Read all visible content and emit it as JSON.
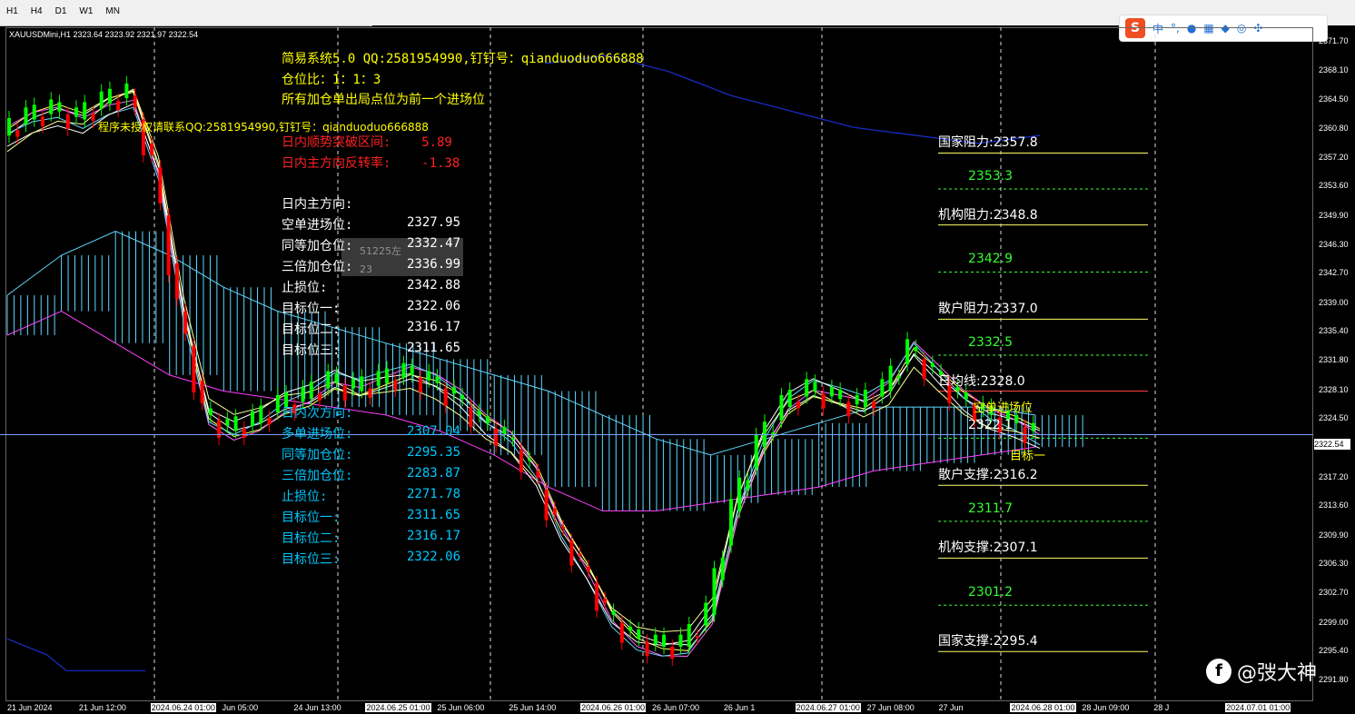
{
  "toolbar": {
    "timeframes": [
      "H1",
      "H4",
      "D1",
      "W1",
      "MN"
    ],
    "ime": {
      "logo": "S",
      "items": [
        "中",
        "°,",
        "mic-icon",
        "keyboard-icon",
        "shirt-icon",
        "game-icon",
        "tool-icon"
      ]
    }
  },
  "symbol_header": "XAUUSDMini,H1  2323.64 2323.92 2321.97 2322.54",
  "info_panel": {
    "line1": "简易系统5.0 QQ:2581954990,钉钉号：qianduoduo666888",
    "line2": "仓位比：1：1：3",
    "line3": "所有加仓单出局点位为前一个进场位",
    "auth": "程序未授权请联系QQ:2581954990,钉钉号：qianduoduo666888",
    "breakout": "日内顺势突破区间:    5.89",
    "reversal": "日内主方向反转率:    -1.38",
    "main_dir": "日内主方向:",
    "short_rows": [
      {
        "label": "空单进场位:",
        "value": "2327.95"
      },
      {
        "label": "同等加仓位:",
        "value": "2332.47"
      },
      {
        "label": "三倍加仓位:",
        "value": "2336.99"
      },
      {
        "label": "止损位:",
        "value": "2342.88"
      },
      {
        "label": "目标位一:",
        "value": "2322.06"
      },
      {
        "label": "目标位二:",
        "value": "2316.17"
      },
      {
        "label": "目标位三:",
        "value": "2311.65"
      }
    ],
    "sub_dir": "日内次方向:",
    "long_rows": [
      {
        "label": "多单进场位:",
        "value": "2307.04"
      },
      {
        "label": "同等加仓位:",
        "value": "2295.35"
      },
      {
        "label": "三倍加仓位:",
        "value": "2283.87"
      },
      {
        "label": "止损位:",
        "value": "2271.78"
      },
      {
        "label": "目标位一:",
        "value": "2311.65"
      },
      {
        "label": "目标位二:",
        "value": "2316.17"
      },
      {
        "label": "目标位三:",
        "value": "2322.06"
      }
    ],
    "colors": {
      "title": "#ffff00",
      "red": "#ff2020",
      "white": "#ffffff",
      "cyan": "#00c8ff"
    }
  },
  "levels": [
    {
      "name": "国家阻力",
      "value": "2357.8",
      "label": "国家阻力:2357.8",
      "color": "#ffffff",
      "line": "#ffff66",
      "style": "solid"
    },
    {
      "name": "",
      "value": "2353.3",
      "label": "2353.3",
      "color": "#33ff33",
      "line": "#33ff33",
      "style": "dashed"
    },
    {
      "name": "机构阻力",
      "value": "2348.8",
      "label": "机构阻力:2348.8",
      "color": "#ffffff",
      "line": "#ffff66",
      "style": "solid"
    },
    {
      "name": "",
      "value": "2342.9",
      "label": "2342.9",
      "color": "#33ff33",
      "line": "#33ff33",
      "style": "dashed"
    },
    {
      "name": "散户阻力",
      "value": "2337.0",
      "label": "散户阻力:2337.0",
      "color": "#ffffff",
      "line": "#ffff66",
      "style": "solid"
    },
    {
      "name": "",
      "value": "2332.5",
      "label": "2332.5",
      "color": "#33ff33",
      "line": "#33ff33",
      "style": "dashed"
    },
    {
      "name": "日均线",
      "value": "2328.0",
      "label": "日均线:2328.0",
      "color": "#ffffff",
      "line": "#ff4040",
      "style": "solid"
    },
    {
      "name": "",
      "value": "2322.1",
      "label": "2322.1",
      "color": "#ffffff",
      "line": "#33ff33",
      "style": "dashed"
    },
    {
      "name": "散户支撑",
      "value": "2316.2",
      "label": "散户支撑:2316.2",
      "color": "#ffffff",
      "line": "#ffff66",
      "style": "solid"
    },
    {
      "name": "",
      "value": "2311.7",
      "label": "2311.7",
      "color": "#33ff33",
      "line": "#33ff33",
      "style": "dashed"
    },
    {
      "name": "机构支撑",
      "value": "2307.1",
      "label": "机构支撑:2307.1",
      "color": "#ffffff",
      "line": "#ffff66",
      "style": "solid"
    },
    {
      "name": "",
      "value": "2301.2",
      "label": "2301.2",
      "color": "#33ff33",
      "line": "#33ff33",
      "style": "dashed"
    },
    {
      "name": "国家支撑",
      "value": "2295.4",
      "label": "国家支撑:2295.4",
      "color": "#ffffff",
      "line": "#ffff66",
      "style": "solid"
    }
  ],
  "annotations": {
    "short_entry": "空单进场位",
    "target1": "目标一",
    "grey_text1": "51225左",
    "grey_text2": "23"
  },
  "watermark": {
    "logo": "f",
    "text": "@弢大神"
  },
  "current_price": "2322.54",
  "chart_data": {
    "type": "line",
    "title": "",
    "xlabel": "",
    "ylabel": "",
    "ylim": [
      2289.4,
      2373.2
    ],
    "y_ticks": [
      "2371.70",
      "2368.10",
      "2364.50",
      "2360.80",
      "2357.20",
      "2353.60",
      "2349.90",
      "2346.30",
      "2342.70",
      "2339.00",
      "2335.40",
      "2331.80",
      "2328.10",
      "2324.50",
      "2320.90",
      "2317.20",
      "2313.60",
      "2309.90",
      "2306.30",
      "2302.70",
      "2299.00",
      "2295.40",
      "2291.80"
    ],
    "x_labels": [
      "21 Jun 2024",
      "21 Jun 12:00",
      "2024.06.24 01:00",
      "Jun 05:00",
      "24 Jun 13:00",
      "2024.06.25 01:00",
      "25 Jun 06:00",
      "25 Jun 14:00",
      "2024.06.26 01:00",
      "26 Jun 07:00",
      "26 Jun 1",
      "2024.06.27 01:00",
      "27 Jun 08:00",
      "27 Jun",
      "2024.06.28 01:00",
      "28 Jun 09:00",
      "28 J",
      "2024.07.01 01:00"
    ],
    "x_highlight": [
      2,
      5,
      8,
      11,
      14,
      17
    ],
    "series": [
      {
        "values": [
          2360,
          2362,
          2363,
          2362,
          2364,
          2365,
          2356,
          2338,
          2325,
          2323,
          2324,
          2326,
          2327,
          2329,
          2328,
          2329,
          2330,
          2329,
          2327,
          2324,
          2322,
          2318,
          2311,
          2306,
          2300,
          2297,
          2296,
          2296,
          2300,
          2313,
          2321,
          2326,
          2328,
          2327,
          2326,
          2328,
          2333,
          2330,
          2327,
          2325,
          2324,
          2322.5
        ]
      }
    ],
    "upper_band": [
      2340,
      2345,
      2348,
      2345,
      2341,
      2338,
      2336,
      2334,
      2332,
      2330,
      2328,
      2325,
      2322,
      2320,
      2322,
      2324,
      2326,
      2326,
      2326,
      2325
    ],
    "lower_band": [
      2335,
      2338,
      2334,
      2330,
      2328,
      2327,
      2326,
      2325,
      2323,
      2320,
      2316,
      2313,
      2313,
      2314,
      2315,
      2316,
      2318,
      2319,
      2320,
      2321
    ],
    "envelope_top": [
      2369,
      2370,
      2368,
      2365,
      2363,
      2361,
      2360,
      2359,
      2360
    ],
    "envelope_bottom": [
      2297,
      2296,
      2295,
      2293,
      2293,
      2293,
      2293,
      2293
    ]
  }
}
